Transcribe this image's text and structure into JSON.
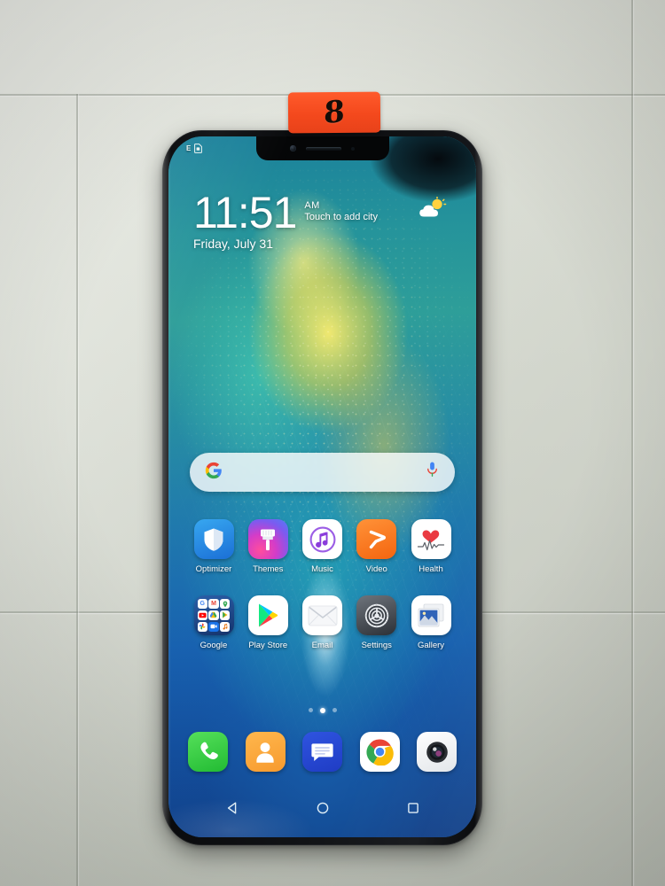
{
  "scene": {
    "description": "Huawei Mate 20 Pro smartphone lying on a pale grey-green tiled surface, home screen on",
    "tag": {
      "number": "8",
      "color": "#f4491d"
    },
    "surface_color": "#dfe3d9"
  },
  "phone": {
    "body_color": "#111316",
    "status_bar": {
      "network": "E",
      "sim_icon": "sim-card-icon"
    },
    "lockscreen_widget": {
      "time": "11:51",
      "ampm": "AM",
      "city_hint": "Touch to add city",
      "date": "Friday, July 31",
      "weather_icon": "sun-behind-cloud-icon"
    },
    "search_bar": {
      "left_icon": "google-g-icon",
      "right_icon": "microphone-icon",
      "placeholder": ""
    },
    "app_rows": [
      [
        {
          "label": "Optimizer",
          "icon": "shield-icon",
          "class": "ic-optimizer"
        },
        {
          "label": "Themes",
          "icon": "paintbrush-icon",
          "class": "ic-themes"
        },
        {
          "label": "Music",
          "icon": "music-note-icon",
          "class": "ic-music"
        },
        {
          "label": "Video",
          "icon": "play-chevron-icon",
          "class": "ic-video"
        },
        {
          "label": "Health",
          "icon": "heart-pulse-icon",
          "class": "ic-health"
        }
      ],
      [
        {
          "label": "Google",
          "icon": "google-folder-icon",
          "class": "ic-google"
        },
        {
          "label": "Play Store",
          "icon": "play-store-icon",
          "class": "ic-play"
        },
        {
          "label": "Email",
          "icon": "envelope-icon",
          "class": "ic-email"
        },
        {
          "label": "Settings",
          "icon": "gear-icon",
          "class": "ic-settings"
        },
        {
          "label": "Gallery",
          "icon": "photo-icon",
          "class": "ic-gallery"
        }
      ]
    ],
    "google_folder_apps": [
      "Google",
      "Gmail",
      "Maps",
      "YouTube",
      "Drive",
      "Play",
      "Photos",
      "Duo",
      "Music"
    ],
    "page_dots": {
      "count": 3,
      "active_index": 1
    },
    "dock": [
      {
        "label": "Phone",
        "icon": "phone-handset-icon",
        "class": "ic-phone"
      },
      {
        "label": "Contacts",
        "icon": "person-icon",
        "class": "ic-contacts"
      },
      {
        "label": "Messages",
        "icon": "speech-bubble-icon",
        "class": "ic-messages"
      },
      {
        "label": "Chrome",
        "icon": "chrome-icon",
        "class": "ic-chrome"
      },
      {
        "label": "Camera",
        "icon": "camera-lens-icon",
        "class": "ic-camera"
      }
    ],
    "nav_bar": [
      {
        "name": "back-button",
        "icon": "triangle-left-icon"
      },
      {
        "name": "home-button",
        "icon": "circle-icon"
      },
      {
        "name": "recents-button",
        "icon": "square-icon"
      }
    ]
  }
}
